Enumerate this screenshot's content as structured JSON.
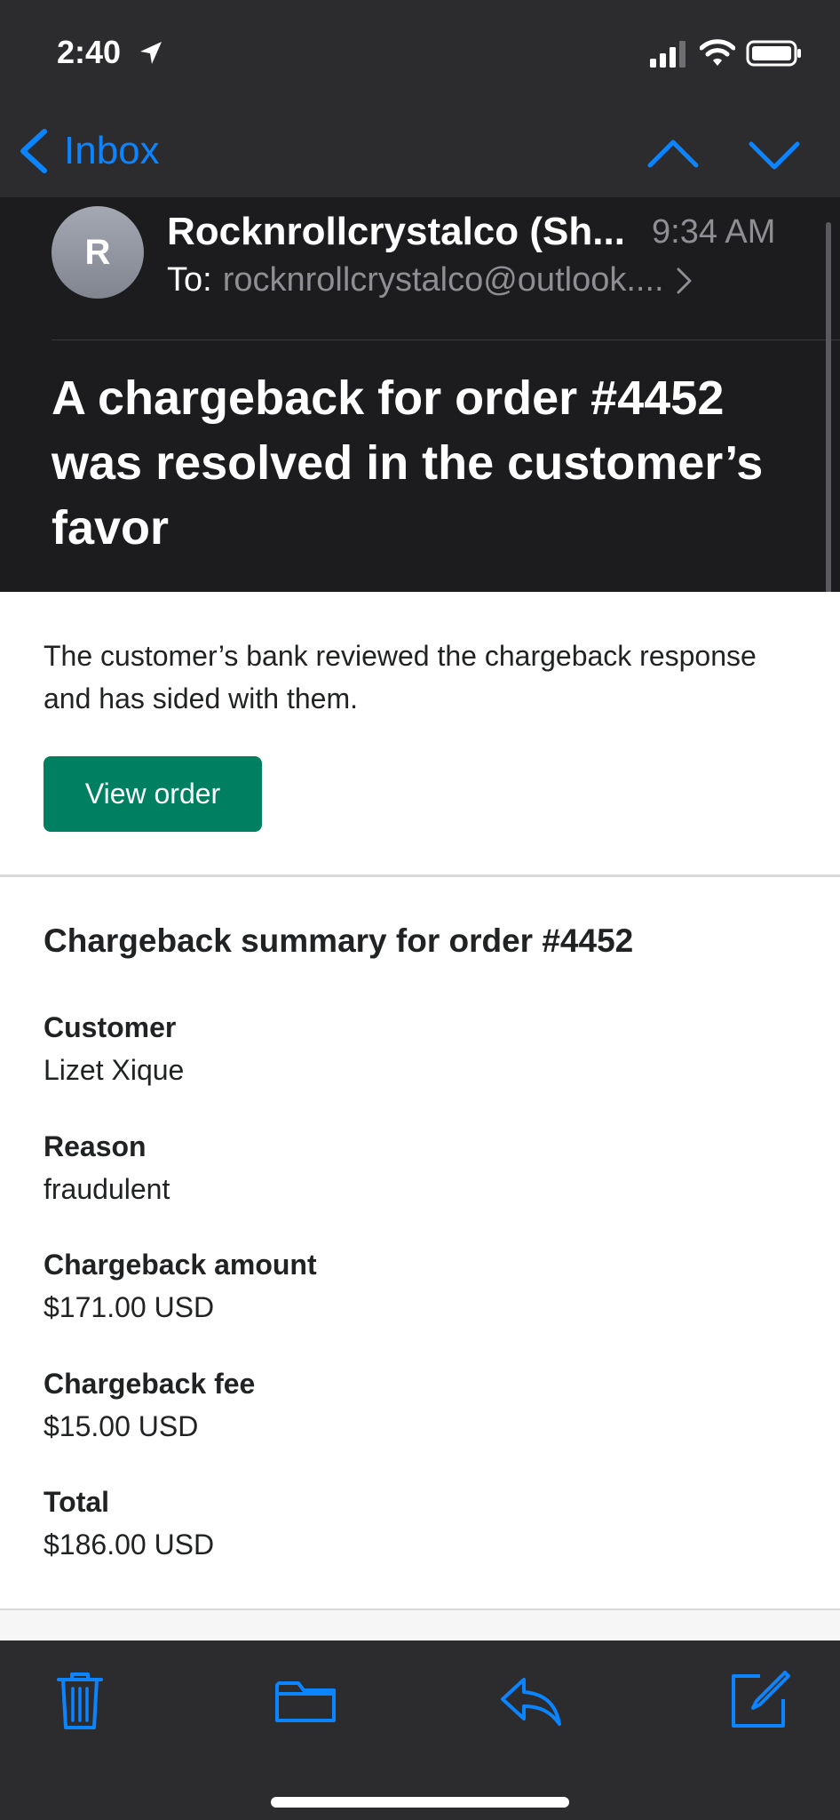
{
  "status_bar": {
    "time": "2:40"
  },
  "nav": {
    "back_label": "Inbox"
  },
  "header": {
    "avatar_initial": "R",
    "sender": "Rocknrollcrystalco (Sh...",
    "time": "9:34 AM",
    "to_label": "To:",
    "to_address": "rocknrollcrystalco@outlook....",
    "subject": "A chargeback for order #4452 was resolved in the customer’s favor"
  },
  "body": {
    "intro": "The customer’s bank reviewed the chargeback response and has sided with them.",
    "view_order_label": "View order",
    "summary_title": "Chargeback summary for order #4452",
    "fields": [
      {
        "label": "Customer",
        "value": "Lizet Xique"
      },
      {
        "label": "Reason",
        "value": "fraudulent"
      },
      {
        "label": "Chargeback amount",
        "value": "$171.00 USD"
      },
      {
        "label": "Chargeback fee",
        "value": "$15.00 USD"
      },
      {
        "label": "Total",
        "value": "$186.00 USD"
      }
    ]
  },
  "toolbar": {
    "icons": [
      "trash-icon",
      "folder-icon",
      "reply-icon",
      "compose-icon"
    ]
  },
  "colors": {
    "accent": "#0a84ff",
    "button_green": "#008060",
    "dark_bg": "#1c1c1e",
    "bar_bg": "#2c2c2e"
  }
}
